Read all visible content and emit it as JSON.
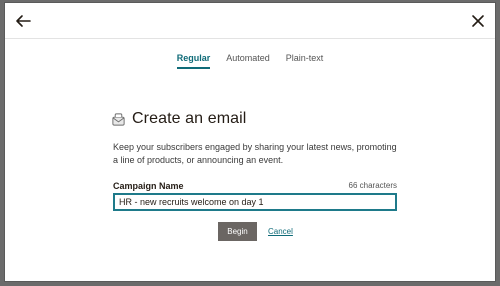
{
  "modal": {
    "back_icon": "arrow-left-icon",
    "close_icon": "close-icon"
  },
  "tabs": [
    {
      "label": "Regular",
      "active": true
    },
    {
      "label": "Automated",
      "active": false
    },
    {
      "label": "Plain-text",
      "active": false
    }
  ],
  "form": {
    "icon": "email-icon",
    "title": "Create an email",
    "description": "Keep your subscribers engaged by sharing your latest news, promoting a line of products, or announcing an event.",
    "campaign_label": "Campaign Name",
    "char_count": "66 characters",
    "campaign_value": "HR - new recruits welcome on day 1",
    "begin_label": "Begin",
    "cancel_label": "Cancel"
  },
  "colors": {
    "accent": "#0f6b78",
    "button_bg": "#6b6663",
    "input_border": "#1e7a8a"
  }
}
